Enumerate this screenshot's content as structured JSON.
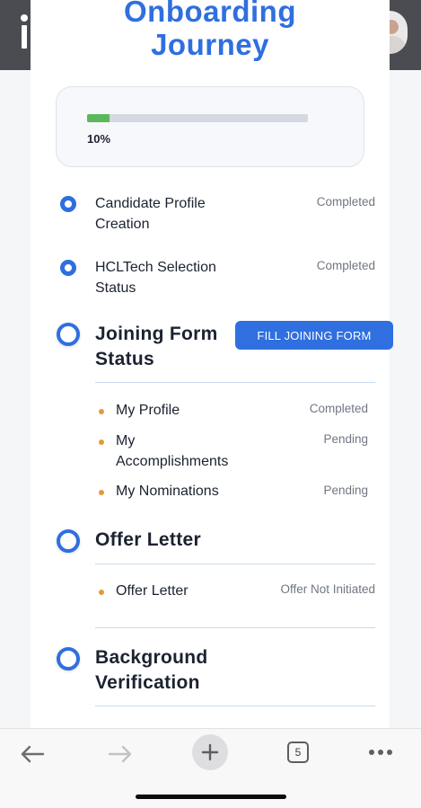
{
  "page": {
    "title_line1": "Onboarding",
    "title_line2": "Journey"
  },
  "progress": {
    "label": "10%",
    "fraction": 0.1
  },
  "steps": [
    {
      "title": "Candidate Profile Creation",
      "status": "Completed"
    },
    {
      "title": "HCLTech Selection Status",
      "status": "Completed"
    }
  ],
  "joining_form": {
    "title": "Joining Form Status",
    "button_label": "FILL JOINING FORM",
    "items": [
      {
        "label": "My Profile",
        "status": "Completed"
      },
      {
        "label": "My Accomplishments",
        "status": "Pending"
      },
      {
        "label": "My Nominations",
        "status": "Pending"
      }
    ]
  },
  "offer_letter": {
    "title": "Offer Letter",
    "items": [
      {
        "label": "Offer Letter",
        "status": "Offer Not Initiated"
      }
    ]
  },
  "background_verification": {
    "title": "Background Verification"
  },
  "browser": {
    "tab_count": "5",
    "icons": [
      "back-arrow-icon",
      "forward-arrow-icon",
      "plus-icon",
      "tabs-icon",
      "more-icon"
    ]
  },
  "colors": {
    "accent": "#2f6fdf",
    "progress_fill": "#5cb85c",
    "bullet": "#e59a3a",
    "header": "#4a4c51"
  }
}
